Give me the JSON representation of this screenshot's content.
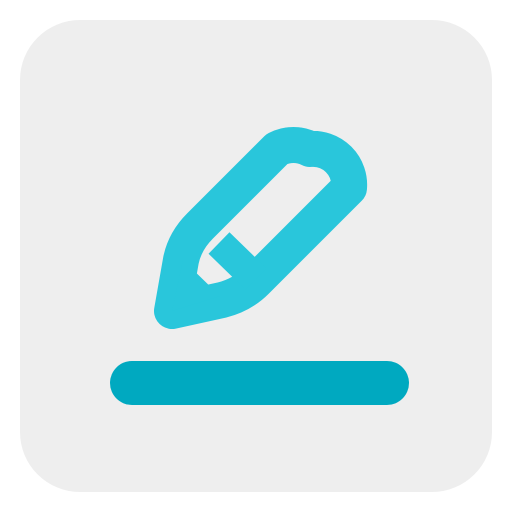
{
  "icon": {
    "name": "edit-pencil-icon",
    "colors": {
      "tile_background": "#eeeeee",
      "pencil_stroke": "#29c6db",
      "underline": "#00a9c0"
    }
  }
}
